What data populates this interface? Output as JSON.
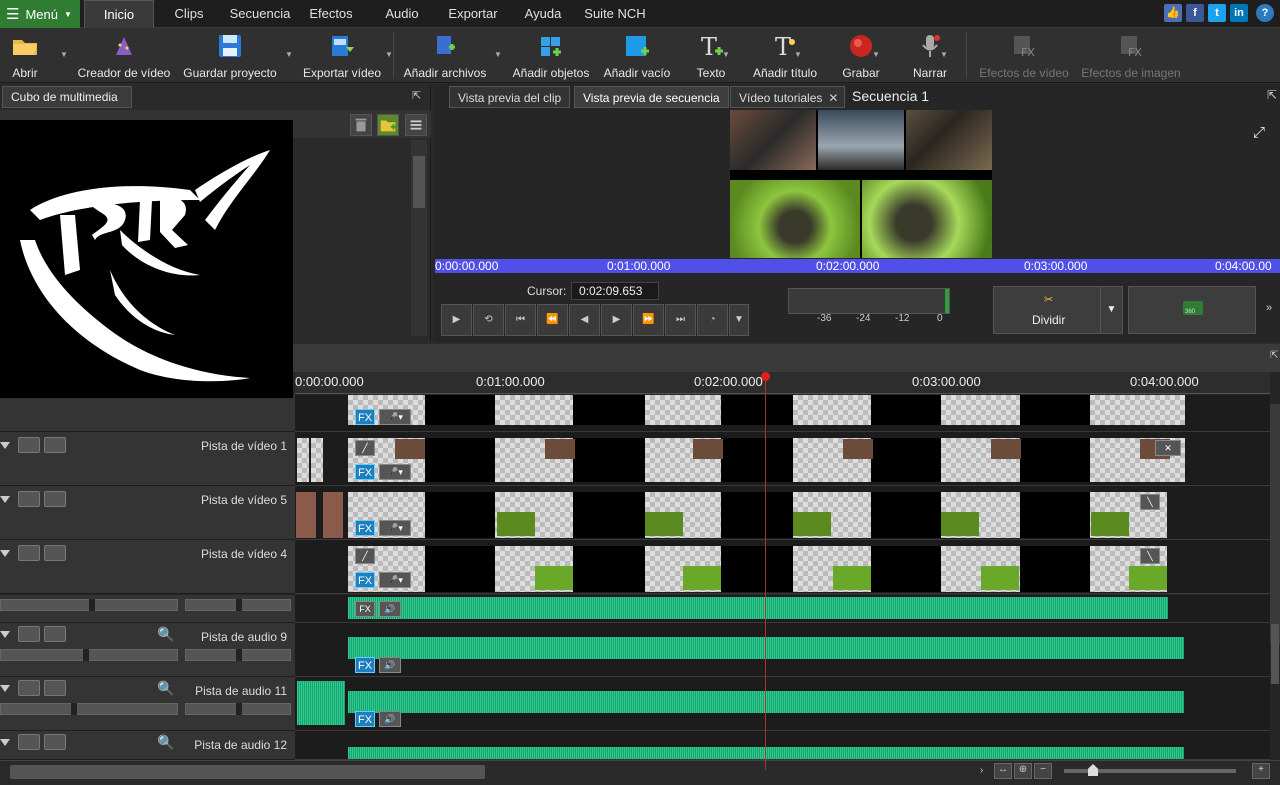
{
  "menubar": {
    "menu_label": "Menú",
    "tabs": [
      "Inicio",
      "Clips",
      "Secuencia",
      "Efectos",
      "Audio",
      "Exportar",
      "Ayuda",
      "Suite NCH"
    ],
    "active_tab": "Inicio"
  },
  "toolbar": {
    "items": [
      "Abrir",
      "Creador de vídeo",
      "Guardar proyecto",
      "Exportar vídeo",
      "Añadir archivos",
      "Añadir objetos",
      "Añadir vacío",
      "Texto",
      "Añadir título",
      "Grabar",
      "Narrar",
      "Efectos de vídeo",
      "Efectos de imagen"
    ]
  },
  "media": {
    "tab_label": "Cubo de multimedia"
  },
  "preview": {
    "tabs": [
      "Vista previa del clip",
      "Vista previa de secuencia",
      "Vídeo tutoriales",
      "Secuencia 1"
    ],
    "active_tab": "Vista previa de secuencia",
    "seek_labels": [
      "0:00:00.000",
      "0:01:00.000",
      "0:02:00.000",
      "0:03:00.000",
      "0:04:00.00"
    ],
    "cursor_label": "Cursor:",
    "cursor_value": "0:02:09.653",
    "meter_labels": [
      "-36",
      "-24",
      "-12",
      "0"
    ],
    "split_label": "Dividir",
    "btn360_label": "360"
  },
  "timeline": {
    "ruler_labels": [
      "0:00:00.000",
      "0:01:00.000",
      "0:02:00.000",
      "0:03:00.000",
      "0:04:00.000"
    ],
    "tracks": [
      {
        "name": "Pista de vídeo 1",
        "type": "video"
      },
      {
        "name": "Pista de vídeo 5",
        "type": "video"
      },
      {
        "name": "Pista de vídeo 4",
        "type": "video"
      },
      {
        "name": "Pista de audio 9",
        "type": "audio"
      },
      {
        "name": "Pista de audio 11",
        "type": "audio"
      },
      {
        "name": "Pista de audio 12",
        "type": "audio"
      }
    ],
    "fx_label": "FX"
  },
  "colors": {
    "accent_green": "#2e7d32",
    "seek_blue": "#5050e8",
    "playhead_red": "#e02020",
    "wave_green": "#2ecc8f"
  }
}
